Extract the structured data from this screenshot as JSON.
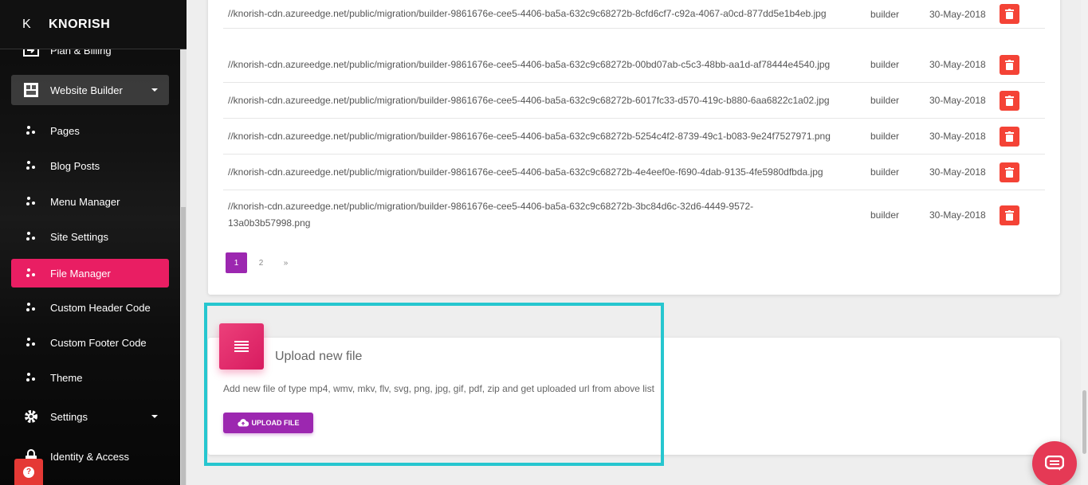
{
  "brand": {
    "mini": "K",
    "name": "KNORISH"
  },
  "sidebar": {
    "items": [
      {
        "label": "Plan & Billing",
        "icon": "billing-icon"
      },
      {
        "label": "Website Builder",
        "icon": "builder-icon",
        "expanded": true
      },
      {
        "label": "Pages",
        "icon": "dots-icon"
      },
      {
        "label": "Blog Posts",
        "icon": "dots-icon"
      },
      {
        "label": "Menu Manager",
        "icon": "dots-icon"
      },
      {
        "label": "Site Settings",
        "icon": "dots-icon"
      },
      {
        "label": "File Manager",
        "icon": "dots-icon",
        "active": true
      },
      {
        "label": "Custom Header Code",
        "icon": "dots-icon"
      },
      {
        "label": "Custom Footer Code",
        "icon": "dots-icon"
      },
      {
        "label": "Theme",
        "icon": "dots-icon"
      },
      {
        "label": "Settings",
        "icon": "gear-icon"
      },
      {
        "label": "Identity & Access",
        "icon": "lock-icon"
      }
    ],
    "help_label": "?"
  },
  "files": {
    "rows": [
      {
        "url": "//knorish-cdn.azureedge.net/public/migration/builder-9861676e-cee5-4406-ba5a-632c9c68272b-8cfd6cf7-c92a-4067-a0cd-877dd5e1b4eb.jpg",
        "type": "builder",
        "date": "30-May-2018"
      },
      {
        "url": "//knorish-cdn.azureedge.net/public/migration/builder-9861676e-cee5-4406-ba5a-632c9c68272b-00bd07ab-c5c3-48bb-aa1d-af78444e4540.jpg",
        "type": "builder",
        "date": "30-May-2018"
      },
      {
        "url": "//knorish-cdn.azureedge.net/public/migration/builder-9861676e-cee5-4406-ba5a-632c9c68272b-6017fc33-d570-419c-b880-6aa6822c1a02.jpg",
        "type": "builder",
        "date": "30-May-2018"
      },
      {
        "url": "//knorish-cdn.azureedge.net/public/migration/builder-9861676e-cee5-4406-ba5a-632c9c68272b-5254c4f2-8739-49c1-b083-9e24f7527971.png",
        "type": "builder",
        "date": "30-May-2018"
      },
      {
        "url": "//knorish-cdn.azureedge.net/public/migration/builder-9861676e-cee5-4406-ba5a-632c9c68272b-4e4eef0e-f690-4dab-9135-4fe5980dfbda.jpg",
        "type": "builder",
        "date": "30-May-2018"
      },
      {
        "url": "//knorish-cdn.azureedge.net/public/migration/builder-9861676e-cee5-4406-ba5a-632c9c68272b-3bc84d6c-32d6-4449-9572-13a0b3b57998.png",
        "type": "builder",
        "date": "30-May-2018"
      }
    ],
    "pagination": {
      "pages": [
        "1",
        "2"
      ],
      "next": "»",
      "current": "1"
    }
  },
  "upload": {
    "title": "Upload new file",
    "description": "Add new file of type mp4, wmv, mkv, flv, svg, png, jpg, gif, pdf, zip and get uploaded url from above list",
    "button_label": "UPLOAD FILE"
  },
  "colors": {
    "accent": "#e91e63",
    "button_purple": "#9c27b0",
    "delete_red": "#f44336",
    "highlight": "#26c6cf"
  }
}
